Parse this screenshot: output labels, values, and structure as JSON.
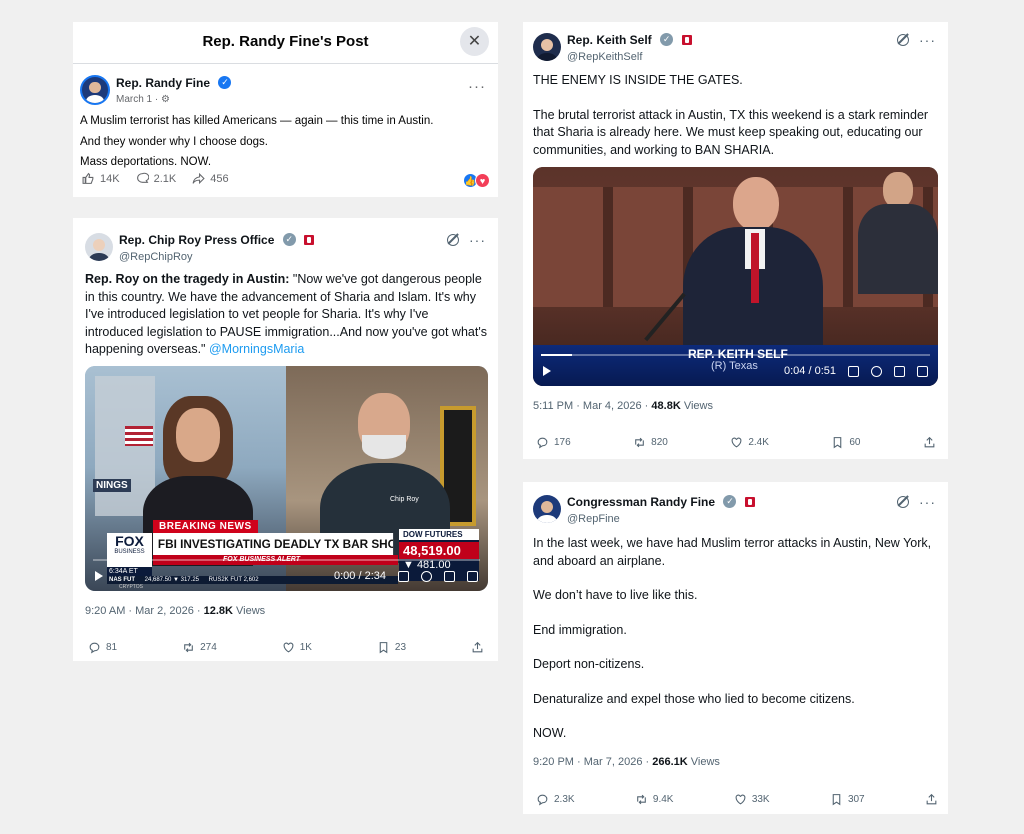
{
  "fb_post": {
    "title": "Rep. Randy Fine's Post",
    "author": "Rep. Randy Fine",
    "date": "March 1 · ",
    "lines": [
      "A Muslim terrorist has killed Americans — again — this time in Austin.",
      "And they wonder why I choose dogs.",
      "Mass deportations.  NOW."
    ],
    "likes": "14K",
    "comments": "2.1K",
    "shares": "456"
  },
  "chip_post": {
    "name": "Rep. Chip Roy Press Office",
    "handle": "@RepChipRoy",
    "text_bold": "Rep. Roy on the tragedy in Austin:",
    "text": " \"Now we've got dangerous people in this country. We have the advancement of Sharia and Islam. It's why I've introduced legislation to vet people for Sharia. It's why I've introduced legislation to PAUSE immigration...And now you've got what's happening overseas.\" ",
    "mention": "@MorningsMaria",
    "video": {
      "breaking": "BREAKING NEWS",
      "headline": "FBI INVESTIGATING DEADLY TX BAR SHOOTING",
      "network": "FOX",
      "network_sub": "BUSINESS",
      "time": "6:34A ET",
      "ticker_label": "NAS FUT",
      "ticker_values": "24,687.50 ▼ 317.25",
      "ticker2": "RUS2K FUT  2,602",
      "dow_label": "DOW FUTURES",
      "dow_value": "48,519.00",
      "dow_change": "▼ 481.00",
      "alert": "FOX BUSINESS ALERT",
      "crypto": "CRYPTOS",
      "side_text": "NINGS",
      "shirt_text": "Chip Roy",
      "timer": "0:00 / 2:34"
    },
    "time": "9:20 AM · Mar 2, 2026 · ",
    "views": "12.8K",
    "views_label": " Views",
    "replies": "81",
    "reposts": "274",
    "likes": "1K",
    "bookmarks": "23"
  },
  "self_post": {
    "name": "Rep. Keith Self",
    "handle": "@RepKeithSelf",
    "p1": "THE ENEMY IS INSIDE THE GATES.",
    "p2": "The brutal terrorist attack in Austin, TX this weekend is a stark reminder that Sharia is already here. We must keep speaking out, educating our communities, and working to BAN SHARIA.",
    "video": {
      "lower_third_name": "REP. KEITH SELF",
      "lower_third_sub": "(R) Texas",
      "timer": "0:04 / 0:51"
    },
    "time": "5:11 PM · Mar 4, 2026 · ",
    "views": "48.8K",
    "views_label": " Views",
    "replies": "176",
    "reposts": "820",
    "likes": "2.4K",
    "bookmarks": "60"
  },
  "fine_post": {
    "name": "Congressman Randy Fine",
    "handle": "@RepFine",
    "paragraphs": [
      "In the last week, we have had Muslim terror attacks in Austin, New York, and aboard an airplane.",
      "We don’t have to live like this.",
      "End immigration.",
      "Deport non-citizens.",
      "Denaturalize and expel those who lied to become citizens.",
      "NOW."
    ],
    "time": "9:20 PM · Mar 7, 2026 · ",
    "views": "266.1K",
    "views_label": " Views",
    "replies": "2.3K",
    "reposts": "9.4K",
    "likes": "33K",
    "bookmarks": "307"
  },
  "colors": {
    "background": "#f0f0f0",
    "x_blue": "#1d9bf0",
    "fb_blue": "#1877f2",
    "text": "#0f1419",
    "muted": "#536471",
    "fox_red": "#d0021b"
  }
}
